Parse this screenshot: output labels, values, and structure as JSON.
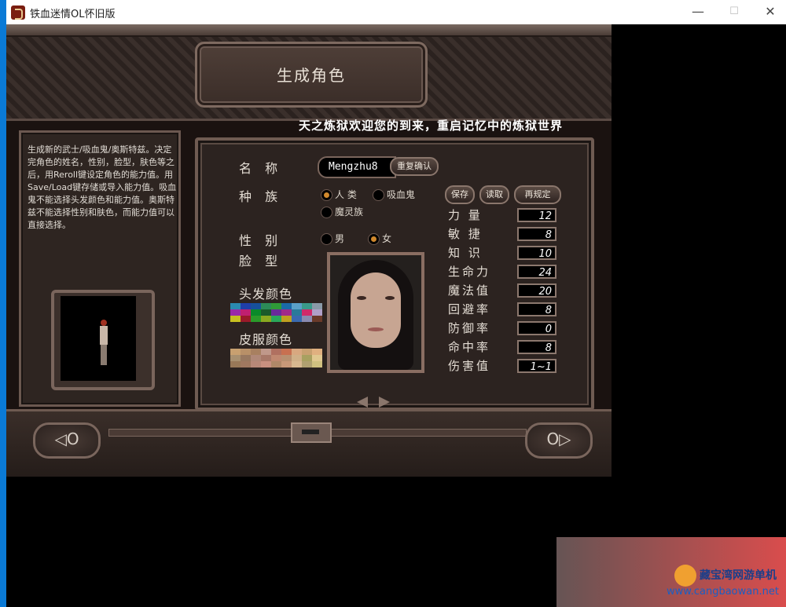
{
  "window": {
    "title": "铁血迷情OL怀旧版",
    "min": "—",
    "max": "☐",
    "close": "✕"
  },
  "header": {
    "title": "生成角色",
    "welcome": "天之炼狱欢迎您的到来，重启记忆中的炼狱世界"
  },
  "info": {
    "description": "生成新的武士/吸血鬼/奥斯特兹。决定完角色的姓名，性别，脸型，肤色等之后，用Reroll键设定角色的能力值。用Save/Load键存储或导入能力值。吸血鬼不能选择头发颜色和能力值。奥斯特兹不能选择性别和肤色，而能力值可以直接选择。"
  },
  "form": {
    "name_label": "名 称",
    "name_value": "Mengzhu8",
    "confirm_label": "重复确认",
    "race_label": "种 族",
    "races": [
      {
        "label": "人 类",
        "selected": true
      },
      {
        "label": "吸血鬼",
        "selected": false
      },
      {
        "label": "魔灵族",
        "selected": false
      }
    ],
    "gender_label": "性 别",
    "genders": [
      {
        "label": "男",
        "selected": false
      },
      {
        "label": "女",
        "selected": true
      }
    ],
    "face_label": "脸 型",
    "hair_color_label": "头发颜色",
    "skin_color_label": "皮服颜色"
  },
  "actions": {
    "save": "保存",
    "load": "读取",
    "reroll": "再规定"
  },
  "stats": [
    {
      "label": "力 量",
      "value": "12"
    },
    {
      "label": "敏 捷",
      "value": "8"
    },
    {
      "label": "知 识",
      "value": "10"
    },
    {
      "label": "生命力",
      "value": "24"
    },
    {
      "label": "魔法值",
      "value": "20"
    },
    {
      "label": "回避率",
      "value": "8"
    },
    {
      "label": "防御率",
      "value": "0"
    },
    {
      "label": "命中率",
      "value": "8"
    },
    {
      "label": "伤害值",
      "value": "1~1"
    }
  ],
  "nav": {
    "prev": "◁O",
    "next": "O▷"
  },
  "colors": {
    "hair": [
      "#2a8ab0",
      "#1f3fa8",
      "#16509a",
      "#2c8a58",
      "#2f9a38",
      "#1a6aa8",
      "#5aa0c8",
      "#3a9a8a",
      "#8a9aa8",
      "#9a2aa8",
      "#c02070",
      "#0a8a2a",
      "#1a5a2a",
      "#6a2a9a",
      "#a02a8a",
      "#2a7a9a",
      "#d02a6a",
      "#b0a0c8",
      "#c8c020",
      "#9a1a2a",
      "#2a9a2a",
      "#8aa820",
      "#2aa85a",
      "#c0a020",
      "#3a6ab0",
      "#8a8ab0",
      "#6a3a2a"
    ],
    "skin": [
      "#c8a070",
      "#b89068",
      "#a88060",
      "#c0988a",
      "#b07060",
      "#c87050",
      "#d8a880",
      "#c8a070",
      "#e0b080",
      "#a89070",
      "#987860",
      "#b08878",
      "#a87868",
      "#c08870",
      "#b89070",
      "#d0b088",
      "#a8a060",
      "#e0c890",
      "#987858",
      "#a07860",
      "#b88878",
      "#c89080",
      "#b08868",
      "#c89878",
      "#d8b890",
      "#b0a070",
      "#d0c080"
    ]
  },
  "watermark": {
    "line1": "藏宝湾网游单机",
    "line2": "www.cangbaowan.net"
  }
}
